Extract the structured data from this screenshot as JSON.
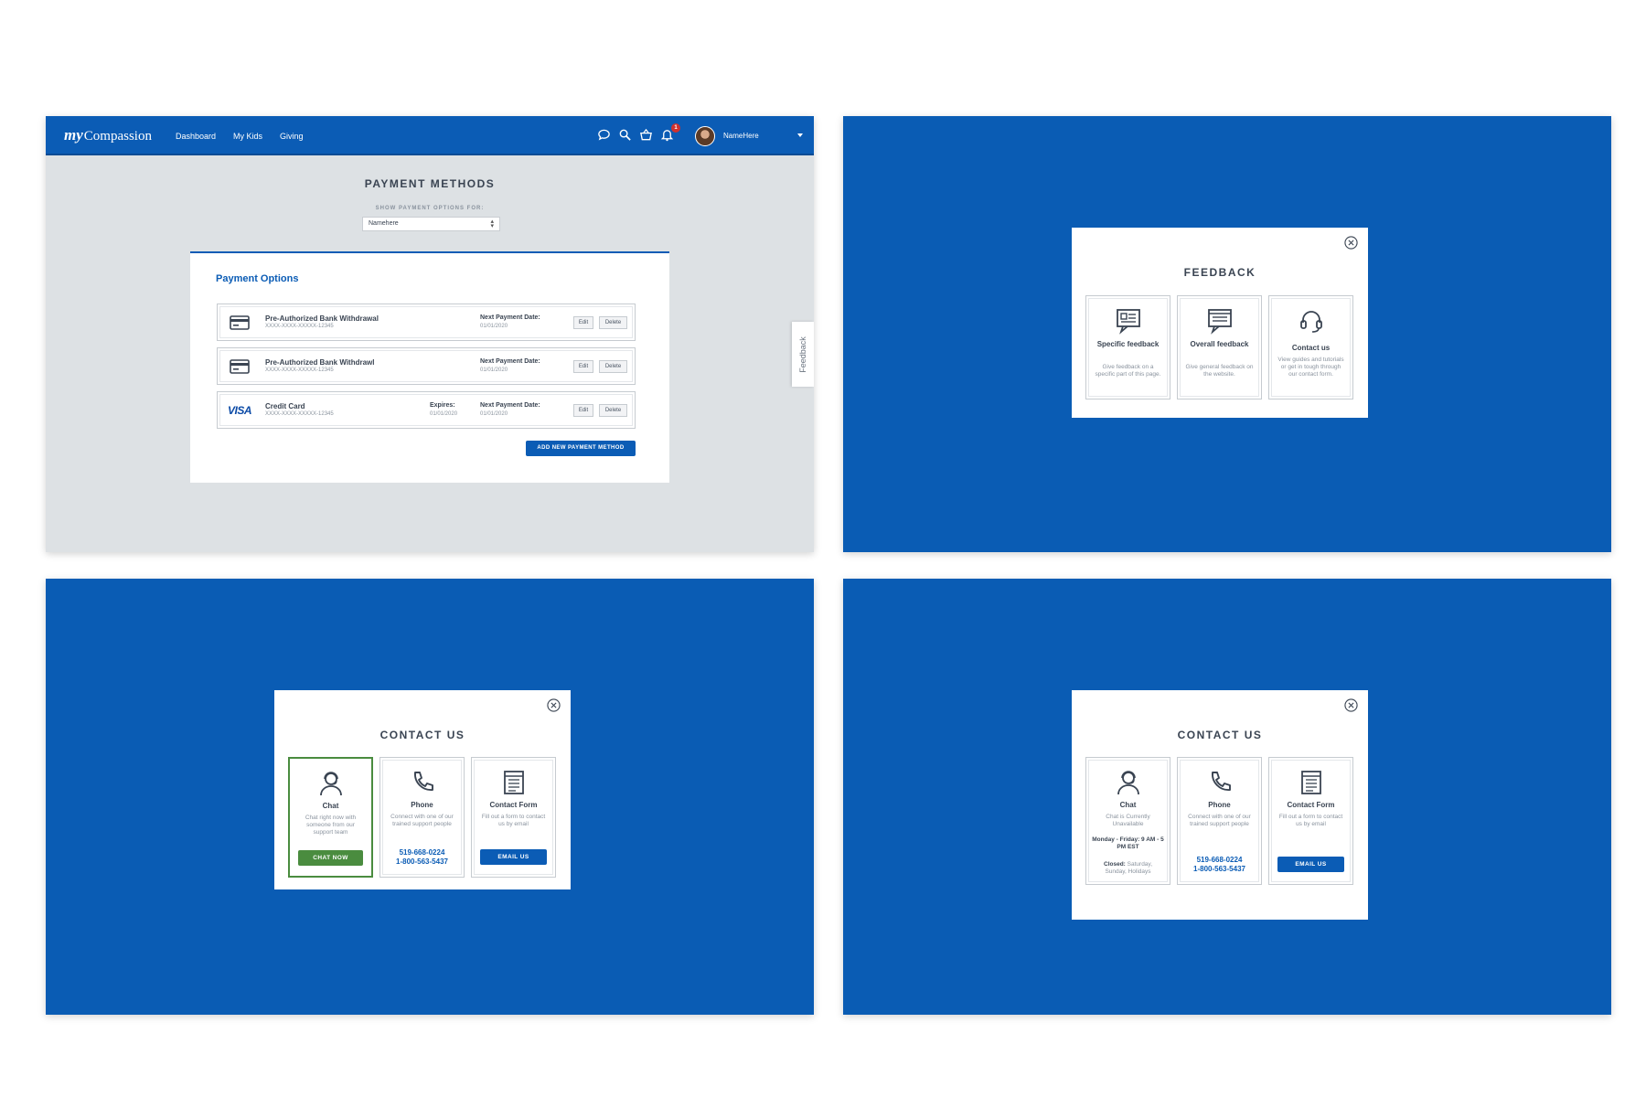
{
  "nav": {
    "logo_my": "my",
    "logo_rest": "Compassion",
    "links": [
      "Dashboard",
      "My Kids",
      "Giving"
    ],
    "notification_count": "1",
    "username": "NameHere",
    "icons": [
      "chat-icon",
      "search-icon",
      "basket-icon",
      "bell-icon"
    ]
  },
  "payment": {
    "title": "PAYMENT METHODS",
    "show_for_label": "SHOW PAYMENT OPTIONS FOR:",
    "selected_person": "Namehere",
    "card_title": "Payment Options",
    "rows": [
      {
        "icon": "credit-card-icon",
        "name": "Pre-Authorized Bank Withdrawal",
        "number": "XXXX-XXXX-XXXXX-12345",
        "next_label": "Next Payment Date:",
        "next_date": "01/01/2020",
        "edit": "Edit",
        "delete": "Delete"
      },
      {
        "icon": "credit-card-icon",
        "name": "Pre-Authorized Bank Withdrawl",
        "number": "XXXX-XXXX-XXXXX-12345",
        "next_label": "Next Payment Date:",
        "next_date": "01/01/2020",
        "edit": "Edit",
        "delete": "Delete"
      },
      {
        "icon": "visa-icon",
        "visa_text": "VISA",
        "name": "Credit Card",
        "number": "XXXX-XXXX-XXXXX-12345",
        "expires_label": "Expires:",
        "expires_date": "01/01/2020",
        "next_label": "Next Payment Date:",
        "next_date": "01/01/2020",
        "edit": "Edit",
        "delete": "Delete"
      }
    ],
    "add_button": "ADD NEW PAYMENT METHOD",
    "feedback_tab": "Feedback"
  },
  "feedback_modal": {
    "title": "FEEDBACK",
    "options": [
      {
        "icon": "specific-feedback-icon",
        "title": "Specific feedback",
        "desc": "Give feedback on a specific part of this page."
      },
      {
        "icon": "overall-feedback-icon",
        "title": "Overall feedback",
        "desc": "Give general feedback on the website."
      },
      {
        "icon": "headset-icon",
        "title": "Contact us",
        "desc": "View guides and tutorials or get in tough through our contact form."
      }
    ]
  },
  "contact_modal_a": {
    "title": "CONTACT US",
    "chat": {
      "title": "Chat",
      "desc": "Chat right now with someone from our support team",
      "button": "CHAT NOW"
    },
    "phone": {
      "title": "Phone",
      "desc": "Connect with one of our trained support people",
      "phone1": "519-668-0224",
      "phone2": "1-800-563-5437"
    },
    "form": {
      "title": "Contact Form",
      "desc": "Fill out a form to contact us by email",
      "button": "EMAIL US"
    }
  },
  "contact_modal_b": {
    "title": "CONTACT US",
    "chat": {
      "title": "Chat",
      "desc": "Chat is Currently Unavailable",
      "hours": "Monday - Friday: 9 AM - 5 PM EST",
      "closed_label": "Closed:",
      "closed_days": "Saturday, Sunday, Holidays"
    },
    "phone": {
      "title": "Phone",
      "desc": "Connect with one of our trained support people",
      "phone1": "519-668-0224",
      "phone2": "1-800-563-5437"
    },
    "form": {
      "title": "Contact Form",
      "desc": "Fill out a form to contact us by email",
      "button": "EMAIL US"
    }
  },
  "colors": {
    "brand_blue": "#0b5cb5",
    "panel_blue": "#0a5cb4",
    "success_green": "#4a8c3f",
    "badge_red": "#d0312d",
    "page_gray": "#dde1e4"
  }
}
